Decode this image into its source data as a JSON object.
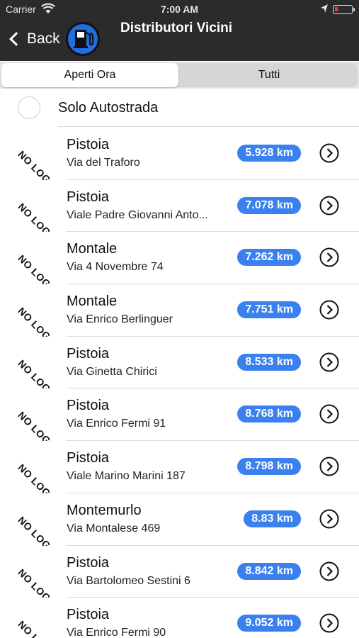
{
  "status_bar": {
    "carrier": "Carrier",
    "time": "7:00 AM",
    "battery_level": 0.2,
    "battery_color": "#ff3b30",
    "icons": [
      "wifi-icon",
      "location-arrow-icon",
      "battery-icon"
    ]
  },
  "nav": {
    "back_label": "Back",
    "title": "Distributori Vicini",
    "logo_icon": "fuel-pump-icon",
    "logo_color": "#1f6fe0"
  },
  "segment": {
    "options": [
      "Aperti Ora",
      "Tutti"
    ],
    "selected": "Aperti Ora"
  },
  "filter": {
    "label": "Solo Autostrada",
    "checked": false
  },
  "accent_color": "#3a80ef",
  "stations": [
    {
      "logo": "NO LOGO",
      "city": "Pistoia",
      "address": "Via del Traforo",
      "distance": "5.928 km"
    },
    {
      "logo": "NO LOGO",
      "city": "Pistoia",
      "address": "Viale Padre Giovanni Anto...",
      "distance": "7.078 km"
    },
    {
      "logo": "NO LOGO",
      "city": "Montale",
      "address": "Via 4 Novembre 74",
      "distance": "7.262 km"
    },
    {
      "logo": "NO LOGO",
      "city": "Montale",
      "address": "Via Enrico Berlinguer",
      "distance": "7.751 km"
    },
    {
      "logo": "NO LOGO",
      "city": "Pistoia",
      "address": "Via Ginetta Chirici",
      "distance": "8.533 km"
    },
    {
      "logo": "NO LOGO",
      "city": "Pistoia",
      "address": "Via Enrico Fermi 91",
      "distance": "8.768 km"
    },
    {
      "logo": "NO LOGO",
      "city": "Pistoia",
      "address": "Viale Marino Marini 187",
      "distance": "8.798 km"
    },
    {
      "logo": "NO LOGO",
      "city": "Montemurlo",
      "address": "Via Montalese 469",
      "distance": "8.83 km"
    },
    {
      "logo": "NO LOGO",
      "city": "Pistoia",
      "address": "Via Bartolomeo Sestini 6",
      "distance": "8.842 km"
    },
    {
      "logo": "NO LOGO",
      "city": "Pistoia",
      "address": "Via Enrico Fermi 90",
      "distance": "9.052 km"
    }
  ]
}
